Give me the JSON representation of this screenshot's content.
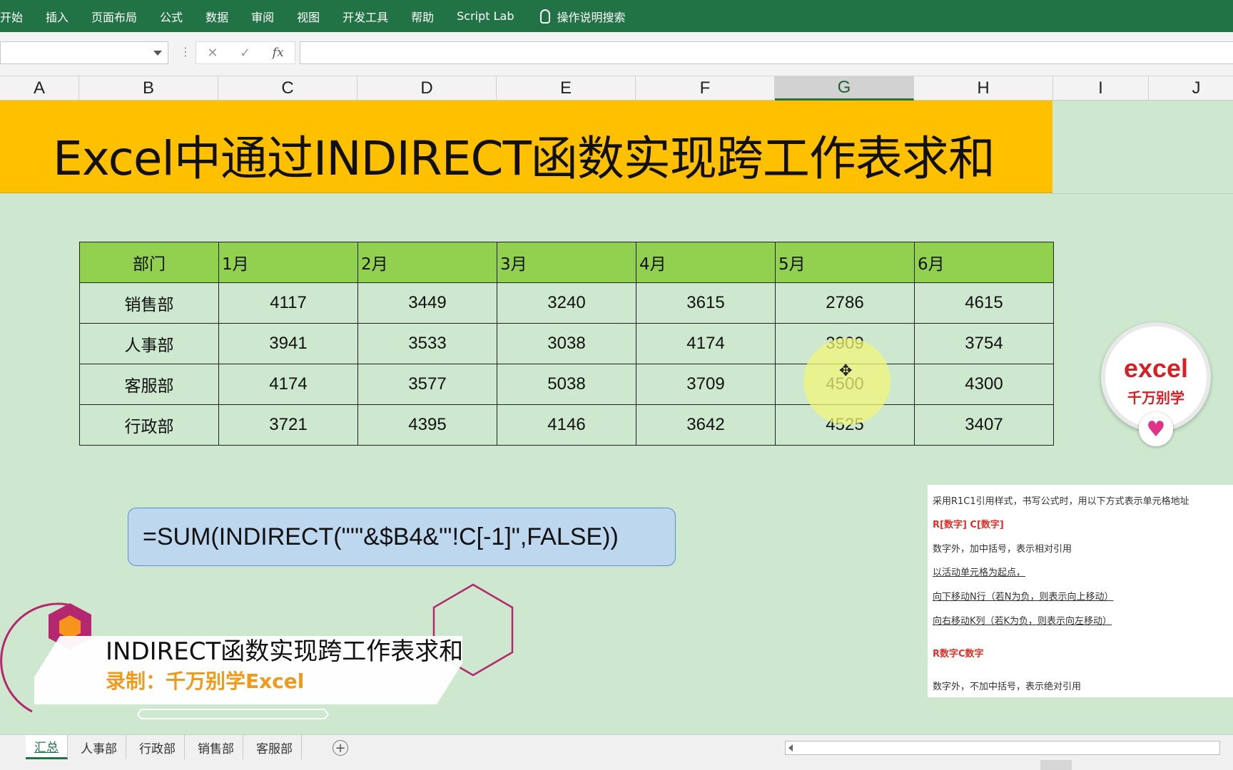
{
  "ribbon": {
    "tabs": [
      "开始",
      "插入",
      "页面布局",
      "公式",
      "数据",
      "审阅",
      "视图",
      "开发工具",
      "帮助",
      "Script Lab"
    ],
    "tell_me": "操作说明搜索"
  },
  "formula_bar": {
    "name_box": "",
    "cancel_glyph": "✕",
    "enter_glyph": "✓",
    "fx_label": "fx",
    "content": ""
  },
  "columns": [
    "A",
    "B",
    "C",
    "D",
    "E",
    "F",
    "G",
    "H",
    "I",
    "J"
  ],
  "selected_column": "G",
  "banner": {
    "title": "Excel中通过INDIRECT函数实现跨工作表求和"
  },
  "table": {
    "headers": [
      "部门",
      "1月",
      "2月",
      "3月",
      "4月",
      "5月",
      "6月"
    ],
    "rows": [
      {
        "dept": "销售部",
        "values": [
          "4117",
          "3449",
          "3240",
          "3615",
          "2786",
          "4615"
        ]
      },
      {
        "dept": "人事部",
        "values": [
          "3941",
          "3533",
          "3038",
          "4174",
          "3909",
          "3754"
        ]
      },
      {
        "dept": "客服部",
        "values": [
          "4174",
          "3577",
          "5038",
          "3709",
          "4500",
          "4300"
        ]
      },
      {
        "dept": "行政部",
        "values": [
          "3721",
          "4395",
          "4146",
          "3642",
          "4525",
          "3407"
        ]
      }
    ]
  },
  "formula_box": "=SUM(INDIRECT(\"'\"&$B4&\"'!C[-1]\",FALSE))",
  "logo": {
    "line1": "excel",
    "line2": "千万别学"
  },
  "notes": [
    "采用R1C1引用样式，书写公式时，用以下方式表示单元格地址",
    "R[数字] C[数字]",
    "数字外，加中括号，表示相对引用",
    "以活动单元格为起点，",
    "向下移动N行（若N为负，则表示向上移动）",
    "向右移动K列（若K为负，则表示向左移动）",
    "R数字C数字",
    "数字外，不加中括号，表示绝对引用"
  ],
  "overlay": {
    "title": "INDIRECT函数实现跨工作表求和",
    "subtitle": "录制：千万别学Excel"
  },
  "sheet_tabs": [
    "汇总",
    "人事部",
    "行政部",
    "销售部",
    "客服部"
  ],
  "active_sheet": "汇总",
  "colors": {
    "ribbon": "#217346",
    "banner": "#ffc000",
    "table_header": "#92d050",
    "sheet_bg": "#cde8cf",
    "formula_box": "#bdd7ee",
    "accent_orange": "#f19a1a",
    "logo_red": "#d91f26"
  }
}
